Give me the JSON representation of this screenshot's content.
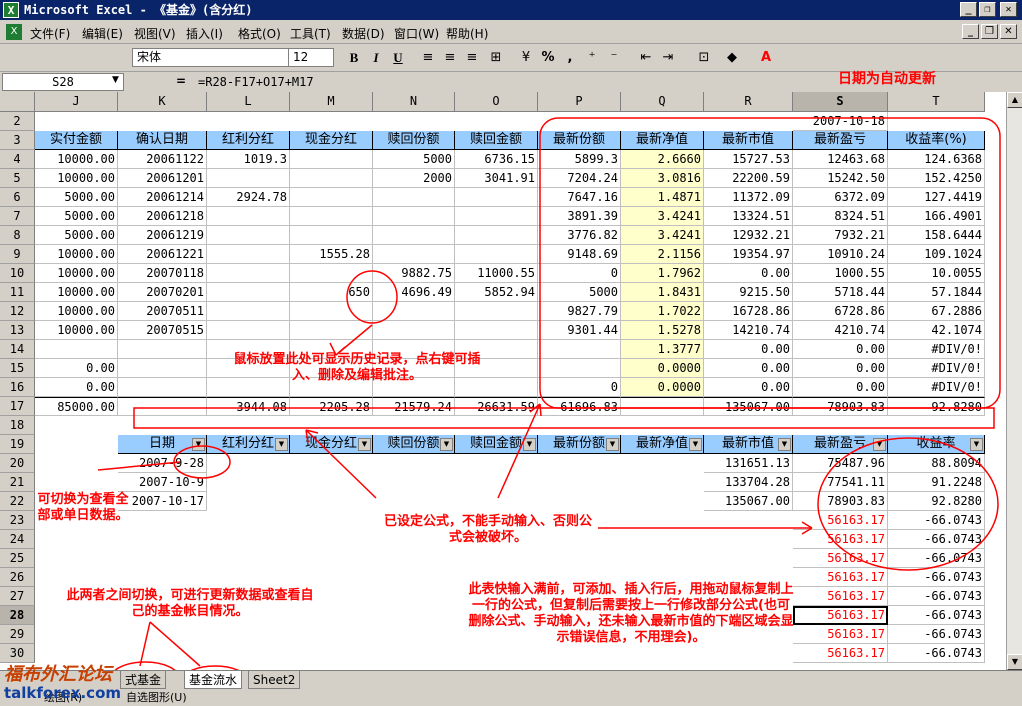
{
  "window": {
    "title": "Microsoft Excel - 《基金》(含分红)",
    "app_icon": "excel-icon"
  },
  "menu": [
    "文件(F)",
    "编辑(E)",
    "视图(V)",
    "插入(I)",
    "格式(O)",
    "工具(T)",
    "数据(D)",
    "窗口(W)",
    "帮助(H)"
  ],
  "toolbar": {
    "font": "宋体",
    "size": "12",
    "bold": "B",
    "italic": "I",
    "underline": "U",
    "percent": "%",
    "comma": ","
  },
  "formula_bar": {
    "name_box": "S28",
    "eq": "=",
    "formula": "=R28-F17+O17+M17"
  },
  "note_top": "日期为自动更新",
  "columns": [
    "J",
    "K",
    "L",
    "M",
    "N",
    "O",
    "P",
    "Q",
    "R",
    "S",
    "T"
  ],
  "rows": [
    "2",
    "3",
    "4",
    "5",
    "6",
    "7",
    "8",
    "9",
    "10",
    "11",
    "12",
    "13",
    "14",
    "15",
    "16",
    "17",
    "18",
    "19",
    "20",
    "21",
    "22",
    "23",
    "24",
    "25",
    "26",
    "27",
    "28",
    "29",
    "30"
  ],
  "s2_date": "2007-10-18",
  "headers": [
    "实付金额",
    "确认日期",
    "红利分红",
    "现金分红",
    "赎回份额",
    "赎回金额",
    "最新份额",
    "最新净值",
    "最新市值",
    "最新盈亏",
    "收益率(%)"
  ],
  "data_rows": [
    [
      "10000.00",
      "20061122",
      "1019.3",
      "",
      "5000",
      "6736.15",
      "5899.3",
      "2.6660",
      "15727.53",
      "12463.68",
      "124.6368"
    ],
    [
      "10000.00",
      "20061201",
      "",
      "",
      "2000",
      "3041.91",
      "7204.24",
      "3.0816",
      "22200.59",
      "15242.50",
      "152.4250"
    ],
    [
      "5000.00",
      "20061214",
      "2924.78",
      "",
      "",
      "",
      "7647.16",
      "1.4871",
      "11372.09",
      "6372.09",
      "127.4419"
    ],
    [
      "5000.00",
      "20061218",
      "",
      "",
      "",
      "",
      "3891.39",
      "3.4241",
      "13324.51",
      "8324.51",
      "166.4901"
    ],
    [
      "5000.00",
      "20061219",
      "",
      "",
      "",
      "",
      "3776.82",
      "3.4241",
      "12932.21",
      "7932.21",
      "158.6444"
    ],
    [
      "10000.00",
      "20061221",
      "",
      "1555.28",
      "",
      "",
      "9148.69",
      "2.1156",
      "19354.97",
      "10910.24",
      "109.1024"
    ],
    [
      "10000.00",
      "20070118",
      "",
      "",
      "9882.75",
      "11000.55",
      "0",
      "1.7962",
      "0.00",
      "1000.55",
      "10.0055"
    ],
    [
      "10000.00",
      "20070201",
      "",
      "650",
      "4696.49",
      "5852.94",
      "5000",
      "1.8431",
      "9215.50",
      "5718.44",
      "57.1844"
    ],
    [
      "10000.00",
      "20070511",
      "",
      "",
      "",
      "",
      "9827.79",
      "1.7022",
      "16728.86",
      "6728.86",
      "67.2886"
    ],
    [
      "10000.00",
      "20070515",
      "",
      "",
      "",
      "",
      "9301.44",
      "1.5278",
      "14210.74",
      "4210.74",
      "42.1074"
    ],
    [
      "",
      "",
      "",
      "",
      "",
      "",
      "",
      "1.3777",
      "0.00",
      "0.00",
      "#DIV/0!"
    ],
    [
      "0.00",
      "",
      "",
      "",
      "",
      "",
      "",
      "0.0000",
      "0.00",
      "0.00",
      "#DIV/0!"
    ],
    [
      "0.00",
      "",
      "",
      "",
      "",
      "",
      "0",
      "0.0000",
      "0.00",
      "0.00",
      "#DIV/0!"
    ],
    [
      "85000.00",
      "",
      "3944.08",
      "2205.28",
      "21579.24",
      "26631.59",
      "61696.83",
      "",
      "135067.00",
      "78903.83",
      "92.8280"
    ]
  ],
  "lower_headers": [
    "日期",
    "红利分红",
    "现金分红",
    "赎回份额",
    "赎回金额",
    "最新份额",
    "最新净值",
    "最新市值",
    "最新盈亏",
    "收益率"
  ],
  "lower_rows": [
    [
      "2007-9-28",
      "131651.13",
      "75487.96",
      "88.8094"
    ],
    [
      "2007-10-9",
      "133704.28",
      "77541.11",
      "91.2248"
    ],
    [
      "2007-10-17",
      "135067.00",
      "78903.83",
      "92.8280"
    ]
  ],
  "lower_red": {
    "s": "56163.17",
    "t": "-66.0743"
  },
  "annotations": {
    "comment": "鼠标放置此处可显示历史记录，点右键可插入、删除及编辑批注。",
    "switch": "可切换为查看全部或单日数据。",
    "formula": "已设定公式，不能手动输入、否则公式会被破坏。",
    "tabs": "此两者之间切换，可进行更新数据或查看自己的基金帐目情况。",
    "fill": "此表快输入满前，可添加、插入行后，用拖动鼠标复制上一行的公式，但复制后需要按上一行修改部分公式(也可删除公式、手动输入，还未输入最新市值的下端区域会显示错误信息，不用理会)。"
  },
  "sheet_tabs": [
    "式基金",
    "基金流水",
    "Sheet2"
  ],
  "drawbar": {
    "draw": "绘图(R)",
    "autoshape": "自选图形(U)"
  },
  "watermark": {
    "text": "福布外汇论坛",
    "site": "talkforex.com"
  }
}
